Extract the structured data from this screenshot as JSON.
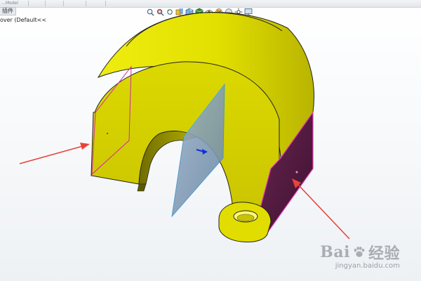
{
  "topbar": {
    "left_fragment": "…Model"
  },
  "feature_tree": {
    "tab_label": "插件",
    "root_item": "over  (Default<<"
  },
  "heads_up_toolbar": {
    "icons": [
      "zoom-to-fit-icon",
      "zoom-area-icon",
      "previous-view-icon",
      "section-view-icon",
      "view-orientation-icon",
      "display-style-icon",
      "hide-show-icon",
      "edit-appearance-icon",
      "apply-scene-icon",
      "view-settings-icon",
      "display-monitor-icon"
    ]
  },
  "colors": {
    "part_yellow": "#e8e600",
    "selected_face": "#5b1e40",
    "plane_fill": "#7f9ab4",
    "arrow_red": "#e8433a",
    "arrow_blue": "#1030d8",
    "edge_magenta": "#cc2aa8"
  },
  "watermark": {
    "logo_text_left": "Bai",
    "logo_text_right": "经验",
    "url": "jingyan.baidu.com"
  }
}
